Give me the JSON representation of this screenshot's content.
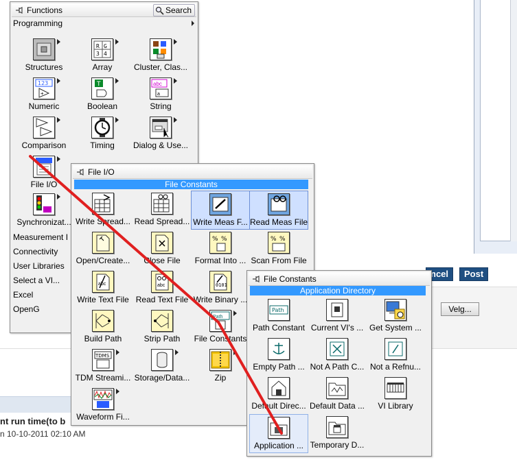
{
  "background": {
    "buttons": [
      "ncel",
      "Post"
    ],
    "velg_label": "Velg...",
    "thread_title": "nt run time(to b",
    "thread_date": "n 10-10-2011 02:10 AM"
  },
  "functions_palette": {
    "title": "Functions",
    "search_label": "Search",
    "category": "Programming",
    "items": [
      "Structures",
      "Array",
      "Cluster, Clas...",
      "Numeric",
      "Boolean",
      "String",
      "Comparison",
      "Timing",
      "Dialog & Use...",
      "File I/O",
      "Synchronizat..."
    ],
    "categories": [
      "Measurement I",
      "Connectivity",
      "User Libraries",
      "Select a VI...",
      "Excel",
      "OpenG"
    ]
  },
  "fileio_palette": {
    "title": "File I/O",
    "header": "File Constants",
    "items": [
      "Write Spread...",
      "Read Spread...",
      "Write Meas F...",
      "Read Meas File",
      "Open/Create...",
      "Close File",
      "Format Into ...",
      "Scan From File",
      "Write Text File",
      "Read Text File",
      "Write Binary ...",
      "Build Path",
      "Strip Path",
      "File Constants",
      "TDM Streami...",
      "Storage/Data...",
      "Zip",
      "Waveform Fi..."
    ]
  },
  "constants_palette": {
    "title": "File Constants",
    "header": "Application Directory",
    "items": [
      "Path Constant",
      "Current VI's ...",
      "Get System ...",
      "Empty Path ...",
      "Not A Path C...",
      "Not a Refnu...",
      "Default Direc...",
      "Default Data ...",
      "VI Library",
      "Application ...",
      "Temporary D..."
    ]
  },
  "icon_text": {
    "path": "Path",
    "abc": "abc",
    "tdms": "TDMS",
    "num": "123"
  },
  "colors": {
    "highlight_bar": "#3399ff",
    "annotation_line": "#e02020"
  }
}
